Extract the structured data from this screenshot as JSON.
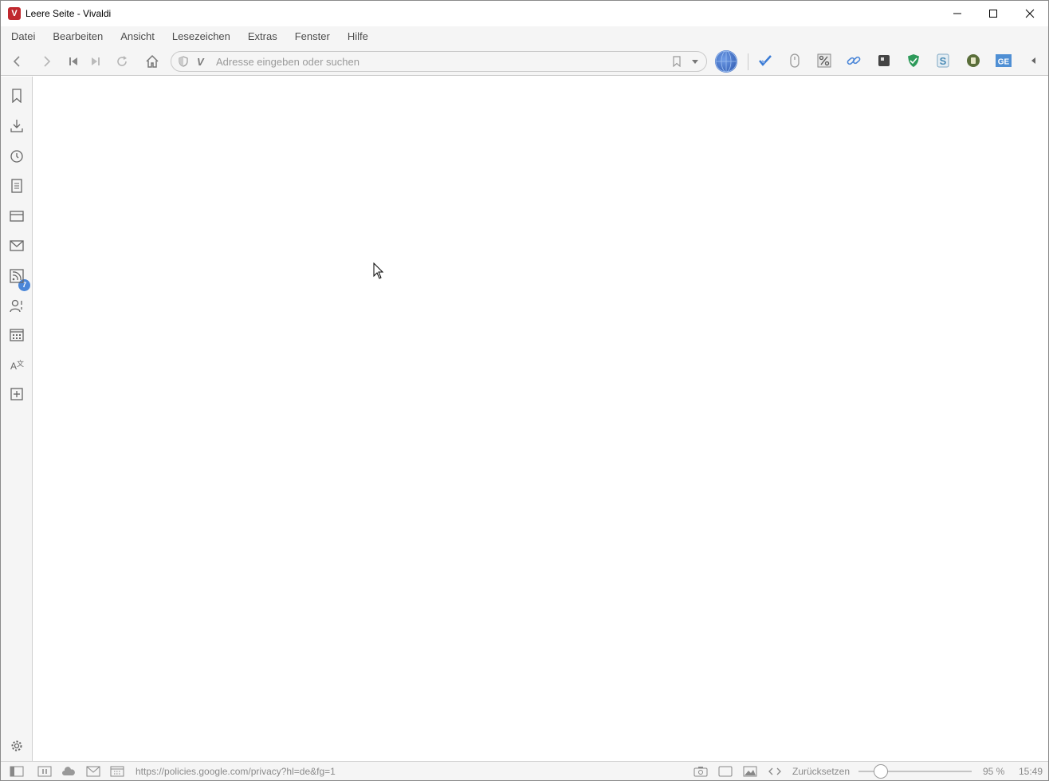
{
  "window": {
    "title": "Leere Seite - Vivaldi",
    "logo_letter": "V",
    "controls": [
      "minimize-icon",
      "maximize-icon",
      "close-icon"
    ]
  },
  "menu": {
    "items": [
      "Datei",
      "Bearbeiten",
      "Ansicht",
      "Lesezeichen",
      "Extras",
      "Fenster",
      "Hilfe"
    ]
  },
  "navbar": {
    "buttons": [
      "back-icon",
      "forward-icon",
      "rewind-icon",
      "fast-forward-icon",
      "reload-icon",
      "home-icon"
    ],
    "address": {
      "value": "",
      "placeholder": "Adresse eingeben oder suchen",
      "prefix_mark": "V"
    },
    "extensions": [
      "globe-icon",
      "checkmark-extension-icon",
      "mouse-icon",
      "percent-icon",
      "link-icon",
      "square-extension-icon",
      "shield-extension-icon",
      "s-extension-icon",
      "power-extension-icon",
      "ge-extension-icon",
      "collapse-arrow-icon"
    ],
    "ge_label": "GE"
  },
  "sidepanel": {
    "items": [
      "bookmarks-icon",
      "downloads-icon",
      "history-icon",
      "notes-icon",
      "window-panel-icon",
      "mail-icon",
      "feeds-icon",
      "contacts-icon",
      "calendar-icon",
      "translate-icon",
      "add-panel-icon"
    ],
    "badge": "7",
    "settings": "gear-icon"
  },
  "statusbar": {
    "url": "https://policies.google.com/privacy?hl=de&fg=1",
    "reset_label": "Zurücksetzen",
    "zoom": "95 %",
    "zoom_fraction": 0.2,
    "time": "15:49"
  },
  "colors": {
    "brand": "#c0282e",
    "badge": "#4a86d8",
    "chrome_bg": "#f5f5f5"
  }
}
